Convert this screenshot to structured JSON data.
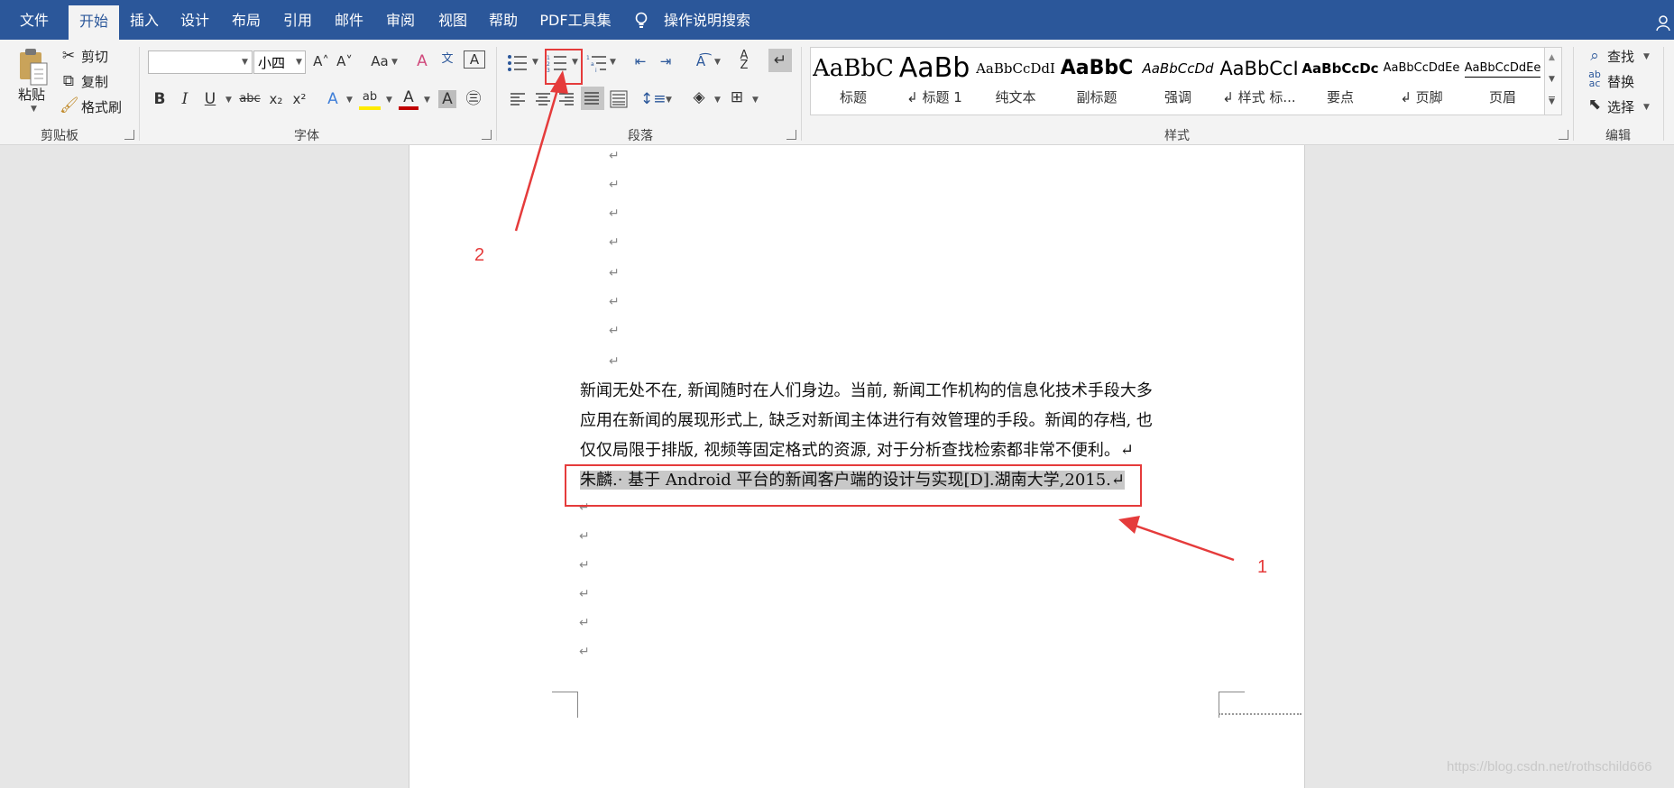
{
  "tabs": [
    "文件",
    "开始",
    "插入",
    "设计",
    "布局",
    "引用",
    "邮件",
    "审阅",
    "视图",
    "帮助",
    "PDF工具集"
  ],
  "tell_me": "操作说明搜索",
  "clipboard": {
    "paste": "粘贴",
    "cut": "剪切",
    "copy": "复制",
    "format_painter": "格式刷",
    "group": "剪贴板"
  },
  "font": {
    "name_value": "",
    "size_value": "小四",
    "group": "字体",
    "case_btn": "Aa"
  },
  "paragraph": {
    "group": "段落"
  },
  "styles": {
    "group": "样式",
    "items": [
      {
        "preview": "AaBbC",
        "name": "标题"
      },
      {
        "preview": "AaBb",
        "name": "↲ 标题 1"
      },
      {
        "preview": "AaBbCcDdI",
        "name": "纯文本"
      },
      {
        "preview": "AaBbC",
        "name": "副标题"
      },
      {
        "preview": "AaBbCcDd",
        "name": "强调"
      },
      {
        "preview": "AaBbCcI",
        "name": "↲ 样式 标..."
      },
      {
        "preview": "AaBbCcDc",
        "name": "要点"
      },
      {
        "preview": "AaBbCcDdEe",
        "name": "↲ 页脚"
      },
      {
        "preview": "AaBbCcDdEe",
        "name": "页眉"
      }
    ]
  },
  "editing": {
    "find": "查找",
    "replace": "替换",
    "select": "选择",
    "group": "编辑"
  },
  "document": {
    "para_mark": "↵",
    "body_lines": [
      "新闻无处不在, 新闻随时在人们身边。当前, 新闻工作机构的信息化技术手段大多",
      "应用在新闻的展现形式上, 缺乏对新闻主体进行有效管理的手段。新闻的存档, 也",
      "仅仅局限于排版, 视频等固定格式的资源, 对于分析查找检索都非常不便利。↵"
    ],
    "reference": "朱麟.· 基于 Android 平台的新闻客户端的设计与实现[D].湖南大学,2015.↵"
  },
  "annotations": {
    "label_1": "1",
    "label_2": "2",
    "color": "#e53b3b"
  },
  "watermark": "https://blog.csdn.net/rothschild666"
}
